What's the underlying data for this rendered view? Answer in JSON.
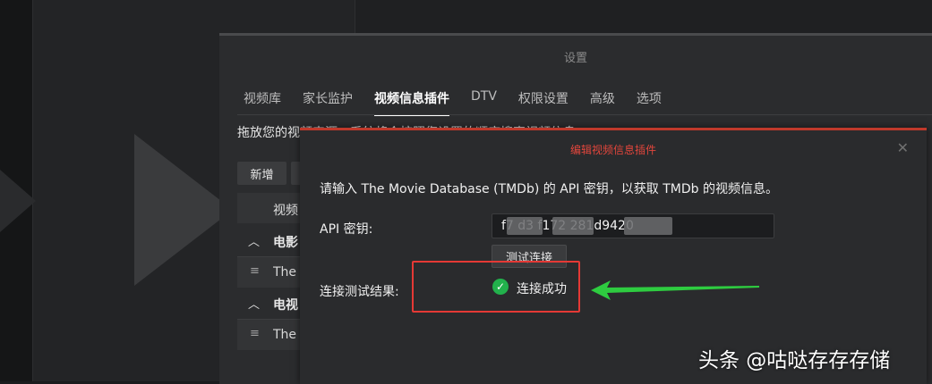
{
  "settings": {
    "title": "设置",
    "tabs": [
      {
        "label": "视频库"
      },
      {
        "label": "家长监护"
      },
      {
        "label": "视频信息插件"
      },
      {
        "label": "DTV"
      },
      {
        "label": "权限设置"
      },
      {
        "label": "高级"
      },
      {
        "label": "选项"
      }
    ],
    "active_tab": "视频信息插件",
    "description": "拖放您的视频来源，系统将会按照您设置的顺序搜索视频信息。",
    "new_button": "新增",
    "table": {
      "header": "视频",
      "groups": [
        {
          "label": "电影",
          "item": "The I"
        },
        {
          "label": "电视",
          "item": "The I"
        }
      ]
    }
  },
  "dialog": {
    "title": "编辑视频信息插件",
    "info": "请输入 The Movie Database (TMDb) 的 API 密钥，以获取 TMDb 的视频信息。",
    "api_label": "API 密钥:",
    "api_value": "f7      d3      f172      281d9420",
    "test_button": "测试连接",
    "result_label": "连接测试结果:",
    "result_text": "连接成功",
    "result_icon": "check-circle-icon",
    "close_icon": "close-icon"
  },
  "colors": {
    "accent_red": "#c0392b",
    "success_green": "#22b14c",
    "annotation_red": "#e53935",
    "annotation_green": "#2ecc40"
  },
  "watermark": "头条 @咕哒存存存储"
}
